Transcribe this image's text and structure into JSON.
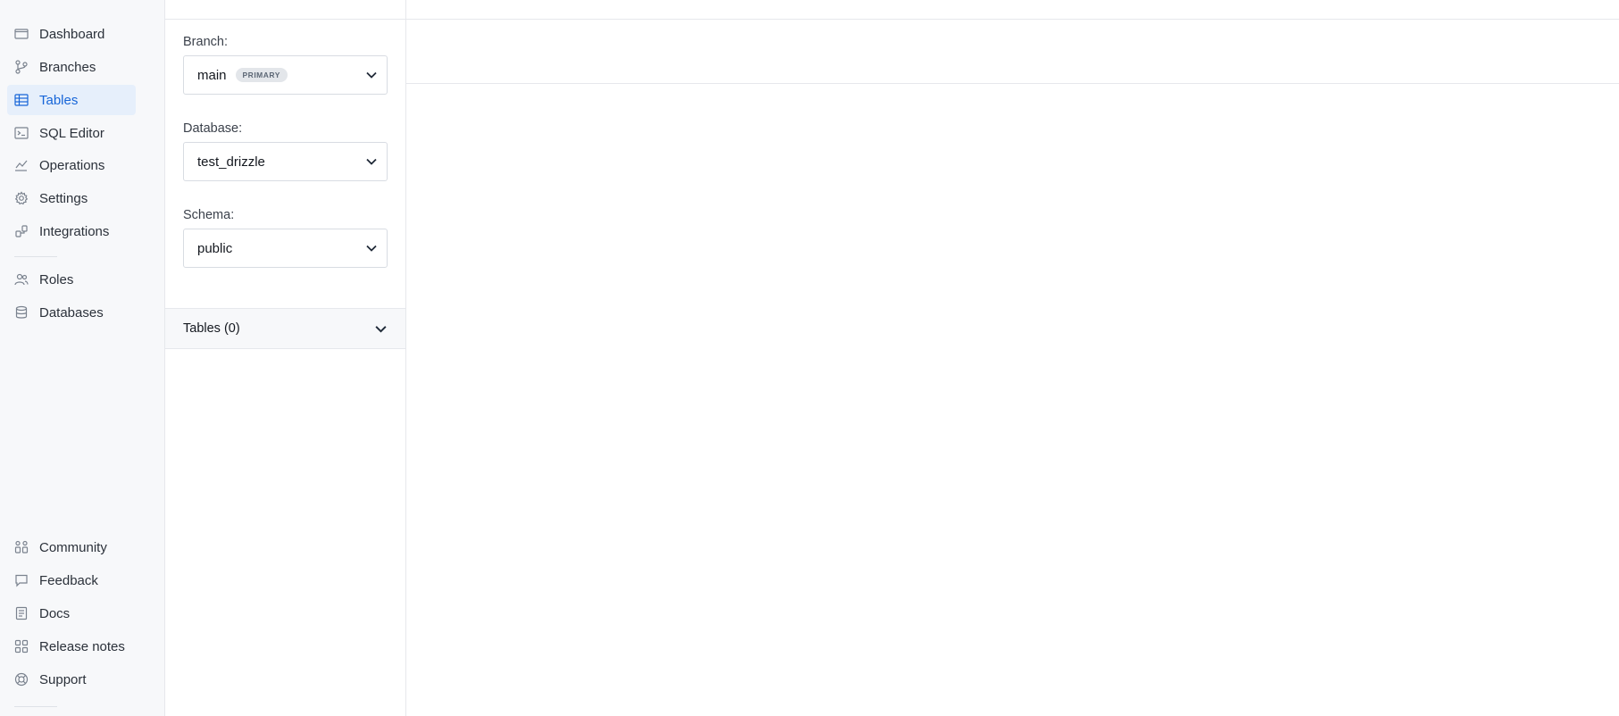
{
  "nav": {
    "items": [
      {
        "label": "Dashboard",
        "icon": "dashboard-icon"
      },
      {
        "label": "Branches",
        "icon": "branches-icon"
      },
      {
        "label": "Tables",
        "icon": "tables-icon",
        "active": true
      },
      {
        "label": "SQL Editor",
        "icon": "sql-editor-icon"
      },
      {
        "label": "Operations",
        "icon": "operations-icon"
      },
      {
        "label": "Settings",
        "icon": "gear-icon"
      },
      {
        "label": "Integrations",
        "icon": "integrations-icon"
      },
      {
        "label": "Roles",
        "icon": "roles-icon"
      },
      {
        "label": "Databases",
        "icon": "database-icon"
      }
    ],
    "footer_items": [
      {
        "label": "Community",
        "icon": "community-icon"
      },
      {
        "label": "Feedback",
        "icon": "feedback-icon"
      },
      {
        "label": "Docs",
        "icon": "docs-icon"
      },
      {
        "label": "Release notes",
        "icon": "release-notes-icon"
      },
      {
        "label": "Support",
        "icon": "support-icon"
      }
    ]
  },
  "panel": {
    "branch_label": "Branch:",
    "branch_value": "main",
    "branch_badge": "PRIMARY",
    "database_label": "Database:",
    "database_value": "test_drizzle",
    "schema_label": "Schema:",
    "schema_value": "public",
    "tables_title": "Tables (0)"
  },
  "colors": {
    "accent": "#1665d8",
    "active_bg": "#e6effb",
    "sidebar_bg": "#f7f8fa",
    "border": "#e6e8ec"
  }
}
